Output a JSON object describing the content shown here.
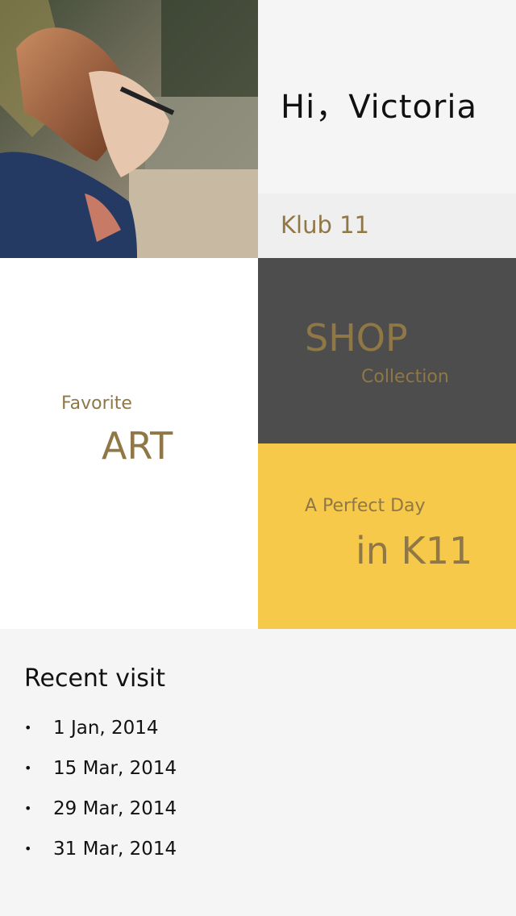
{
  "greeting": {
    "text": "Hi，Victoria"
  },
  "club": {
    "name": "Klub 11"
  },
  "tiles": {
    "art": {
      "small": "Favorite",
      "big": "ART"
    },
    "shop": {
      "big": "SHOP",
      "small": "Collection"
    },
    "day": {
      "small": "A Perfect Day",
      "big": "in K11"
    }
  },
  "recent": {
    "title": "Recent visit",
    "bullet": "•",
    "dates": [
      "1 Jan, 2014",
      "15 Mar, 2014",
      "29 Mar, 2014",
      "31 Mar, 2014"
    ]
  },
  "colors": {
    "gold": "#8f7746",
    "dark_tile": "#4d4d4d",
    "yellow_tile": "#f7c94a",
    "background": "#f5f5f5"
  },
  "images": {
    "profile_photo": "woman-hair-blowing-from-car-window-photo"
  }
}
